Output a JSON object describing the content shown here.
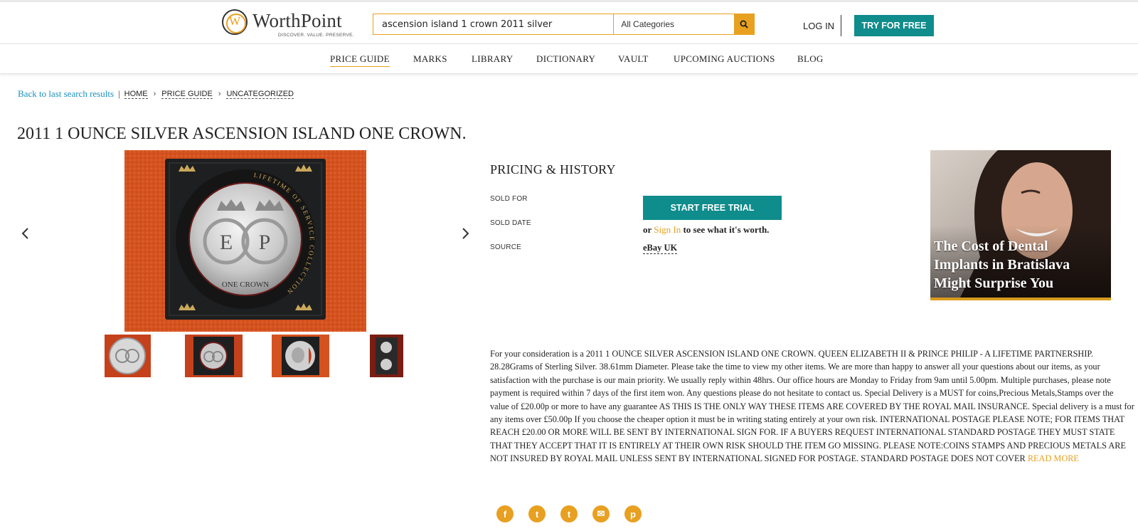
{
  "brand": {
    "name": "WorthPoint",
    "tagline": "DISCOVER. VALUE. PRESERVE.",
    "logo_letter": "W",
    "accent_color": "#e8a020",
    "teal_color": "#0f8c8c"
  },
  "search": {
    "value": "ascension island 1 crown 2011 silver",
    "category": "All Categories",
    "icon": "search-icon"
  },
  "header": {
    "login_label": "LOG IN",
    "try_label": "TRY FOR FREE"
  },
  "nav": {
    "items": [
      {
        "label": "PRICE GUIDE",
        "active": true
      },
      {
        "label": "MARKS"
      },
      {
        "label": "LIBRARY"
      },
      {
        "label": "DICTIONARY"
      },
      {
        "label": "VAULT"
      },
      {
        "label": "UPCOMING AUCTIONS"
      },
      {
        "label": "BLOG"
      }
    ]
  },
  "breadcrumb": {
    "back": "Back to last search results",
    "separator": "|",
    "items": [
      "HOME",
      "PRICE GUIDE",
      "UNCATEGORIZED"
    ],
    "chevron": "›"
  },
  "item": {
    "title": "2011 1 OUNCE SILVER ASCENSION ISLAND ONE CROWN.",
    "coin_ring_text": "LIFETIME OF SERVICE COLLECTION",
    "coin_monogram_left": "E",
    "coin_monogram_right": "P",
    "coin_denomination": "ONE CROWN"
  },
  "gallery": {
    "prev_icon": "chevron-left-icon",
    "next_icon": "chevron-right-icon",
    "thumbnail_count": 4
  },
  "pricing": {
    "heading": "PRICING & HISTORY",
    "sold_for_label": "SOLD FOR",
    "sold_date_label": "SOLD DATE",
    "source_label": "SOURCE",
    "trial_button": "START FREE TRIAL",
    "or_text": "or",
    "sign_in": "Sign In",
    "worth_text": "to see what it's worth.",
    "source_value": "eBay UK"
  },
  "ad": {
    "headline": "The Cost of Dental Implants in Bratislava Might Surprise You"
  },
  "description": {
    "text": "For your consideration is a 2011 1 OUNCE SILVER ASCENSION ISLAND ONE CROWN. QUEEN ELIZABETH II & PRINCE PHILIP - A LIFETIME PARTNERSHIP. 28.28Grams of Sterling Silver. 38.61mm Diameter. Please take the time to view my other items. We are more than happy to answer all your questions about our items, as your satisfaction with the purchase is our main priority. We usually reply within 48hrs. Our office hours are Monday to Friday from 9am until 5.00pm. Multiple purchases, please note payment is required within 7 days of the first item won. Any questions please do not hesitate to contact us. Special Delivery is a MUST for coins,Precious Metals,Stamps over the value of £20.00p or more to have any guarantee AS THIS IS THE ONLY WAY THESE ITEMS ARE COVERED BY THE ROYAL MAIL INSURANCE. Special delivery is a must for any items over £50.00p If you choose the cheaper option it must be in writing stating entirely at your own risk. INTERNATIONAL POSTAGE PLEASE NOTE; FOR ITEMS THAT REACH £20.00 OR MORE WILL BE SENT BY INTERNATIONAL SIGN FOR. IF A BUYERS REQUEST INTERNATIONAL STANDARD POSTAGE THEY MUST STATE THAT THEY ACCEPT THAT IT IS ENTIRELY AT THEIR OWN RISK SHOULD THE ITEM GO MISSING. PLEASE NOTE:COINS STAMPS AND PRECIOUS METALS ARE NOT INSURED BY ROYAL MAIL UNLESS SENT BY INTERNATIONAL SIGNED FOR POSTAGE. STANDARD POSTAGE DOES NOT COVER",
    "read_more": "READ MORE"
  },
  "social": {
    "icons": [
      "facebook-icon",
      "twitter-icon",
      "tumblr-icon",
      "email-icon",
      "pinterest-icon"
    ],
    "glyphs": [
      "f",
      "t",
      "t",
      "✉",
      "p"
    ]
  }
}
